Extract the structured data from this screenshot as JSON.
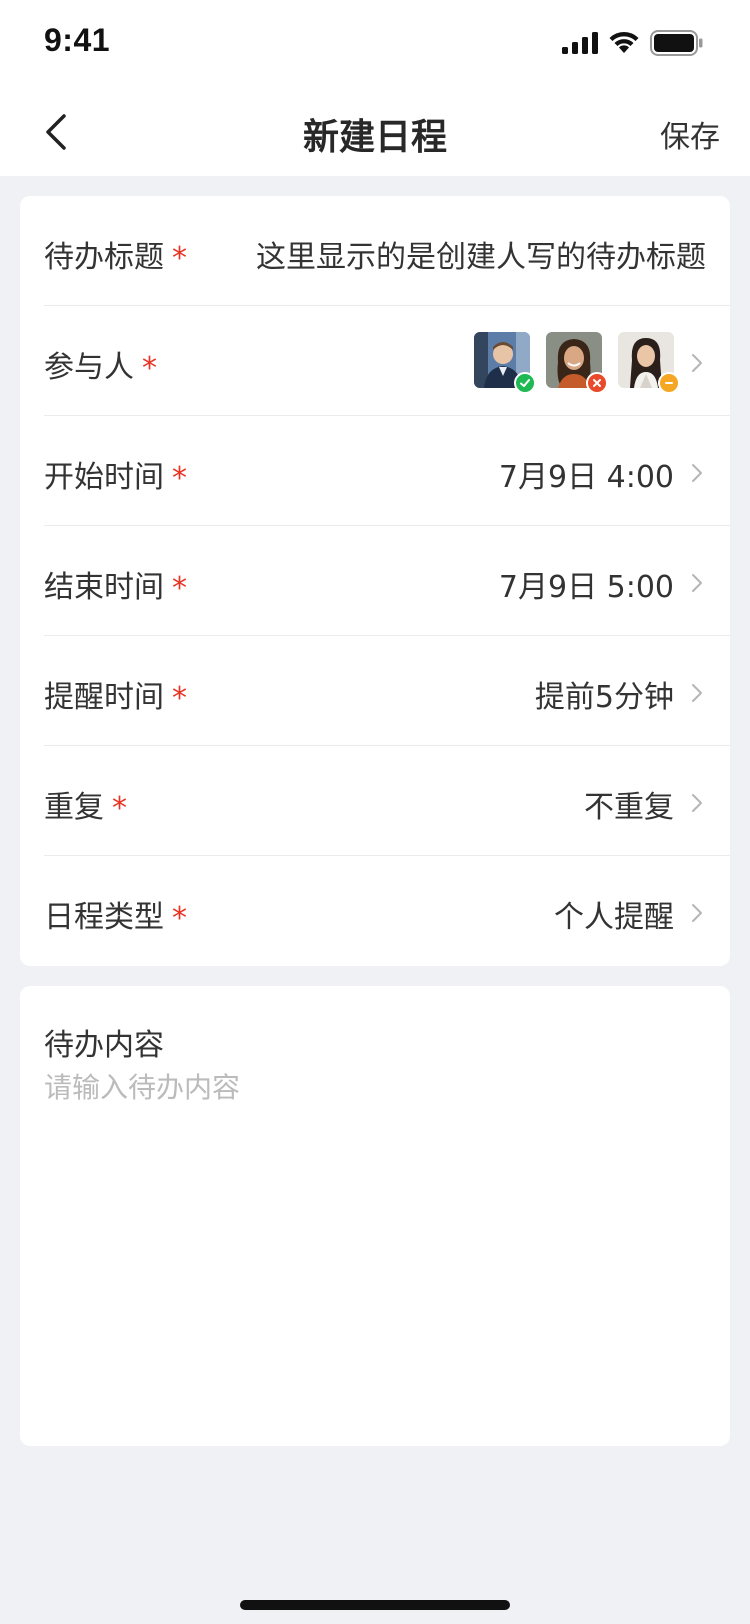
{
  "status": {
    "time": "9:41"
  },
  "nav": {
    "title": "新建日程",
    "save_label": "保存"
  },
  "form": {
    "title_row": {
      "label": "待办标题",
      "required": "*",
      "value": "这里显示的是创建人写的待办标题"
    },
    "participants_row": {
      "label": "参与人",
      "required": "*",
      "participants": [
        {
          "name": "participant-1",
          "status": "accepted",
          "status_color": "#1fb954"
        },
        {
          "name": "participant-2",
          "status": "declined",
          "status_color": "#e84a2a"
        },
        {
          "name": "participant-3",
          "status": "pending",
          "status_color": "#f5a623"
        }
      ]
    },
    "start_row": {
      "label": "开始时间",
      "required": "*",
      "value": "7月9日 4:00"
    },
    "end_row": {
      "label": "结束时间",
      "required": "*",
      "value": "7月9日 5:00"
    },
    "reminder_row": {
      "label": "提醒时间",
      "required": "*",
      "value": "提前5分钟"
    },
    "repeat_row": {
      "label": "重复",
      "required": "*",
      "value": "不重复"
    },
    "type_row": {
      "label": "日程类型",
      "required": "*",
      "value": "个人提醒"
    }
  },
  "content": {
    "label": "待办内容",
    "placeholder": "请输入待办内容",
    "value": ""
  },
  "colors": {
    "required": "#e93323",
    "background": "#f0f1f5",
    "text": "#333333"
  }
}
